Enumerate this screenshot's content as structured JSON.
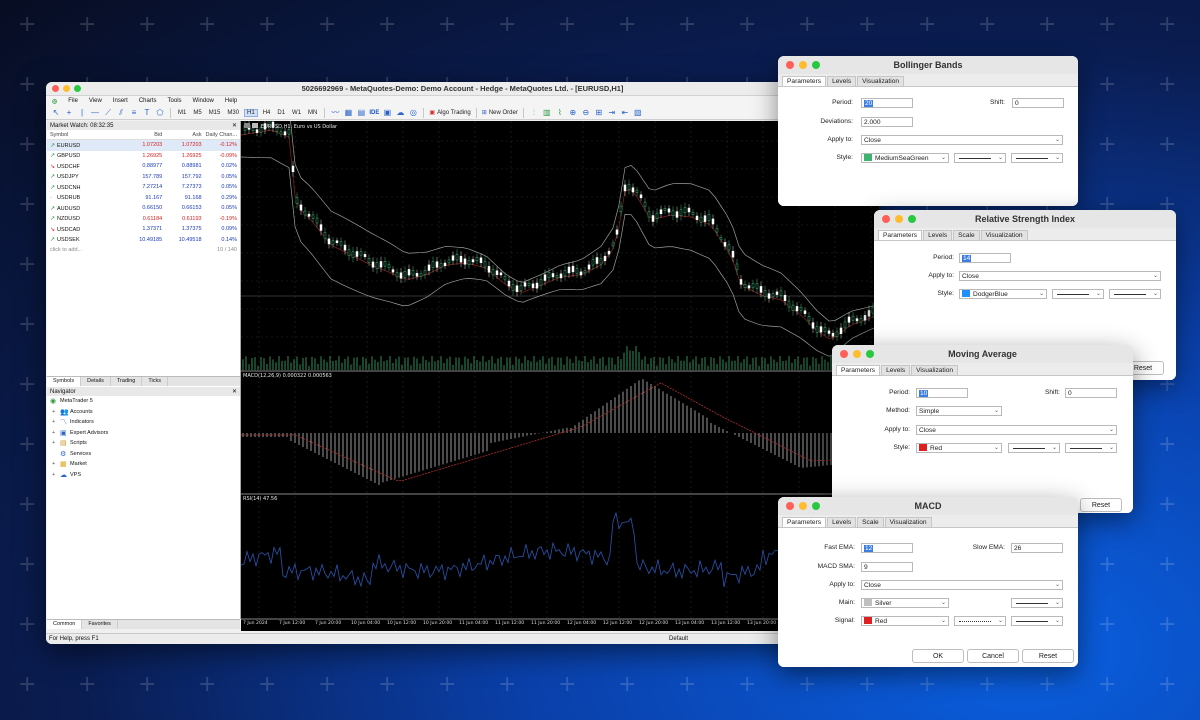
{
  "window": {
    "title": "5026692969 - MetaQuotes-Demo: Demo Account - Hedge - MetaQuotes Ltd. - [EURUSD,H1]",
    "menu": [
      "File",
      "View",
      "Insert",
      "Charts",
      "Tools",
      "Window",
      "Help"
    ],
    "timeframes": [
      "M1",
      "M5",
      "M15",
      "M30",
      "H1",
      "H4",
      "D1",
      "W1",
      "MN"
    ],
    "active_timeframe": "H1",
    "ide_label": "IDE",
    "algo_label": "Algo Trading",
    "new_order_label": "New Order"
  },
  "market_watch": {
    "title": "Market Watch: 08:32:35",
    "columns": [
      "Symbol",
      "Bid",
      "Ask",
      "Daily Chan..."
    ],
    "rows": [
      {
        "symbol": "EURUSD",
        "bid": "1.07203",
        "ask": "1.07203",
        "change": "-0.12%",
        "dir": "up",
        "neg": true
      },
      {
        "symbol": "GBPUSD",
        "bid": "1.26925",
        "ask": "1.26925",
        "change": "-0.09%",
        "dir": "up",
        "neg": true
      },
      {
        "symbol": "USDCHF",
        "bid": "0.88977",
        "ask": "0.88981",
        "change": "0.02%",
        "dir": "down",
        "neg": false
      },
      {
        "symbol": "USDJPY",
        "bid": "157.789",
        "ask": "157.792",
        "change": "0.05%",
        "dir": "up",
        "neg": false
      },
      {
        "symbol": "USDCNH",
        "bid": "7.27214",
        "ask": "7.27373",
        "change": "0.05%",
        "dir": "up",
        "neg": false
      },
      {
        "symbol": "USDRUB",
        "bid": "91.167",
        "ask": "91.168",
        "change": "0.29%",
        "dir": "none",
        "neg": false
      },
      {
        "symbol": "AUDUSD",
        "bid": "0.66150",
        "ask": "0.66153",
        "change": "0.05%",
        "dir": "up",
        "neg": false
      },
      {
        "symbol": "NZDUSD",
        "bid": "0.61184",
        "ask": "0.61193",
        "change": "-0.19%",
        "dir": "up",
        "neg": true
      },
      {
        "symbol": "USDCAD",
        "bid": "1.37371",
        "ask": "1.37375",
        "change": "0.09%",
        "dir": "down",
        "neg": false
      },
      {
        "symbol": "USDSEK",
        "bid": "10.49185",
        "ask": "10.49518",
        "change": "0.14%",
        "dir": "up",
        "neg": false
      }
    ],
    "add_label": "click to add...",
    "count": "10 / 140",
    "tabs": [
      "Symbols",
      "Details",
      "Trading",
      "Ticks"
    ]
  },
  "navigator": {
    "title": "Navigator",
    "root": "MetaTrader 5",
    "items": [
      "Accounts",
      "Indicators",
      "Expert Advisors",
      "Scripts",
      "Services",
      "Market",
      "VPS"
    ],
    "tabs": [
      "Common",
      "Favorites"
    ]
  },
  "status": {
    "help": "For Help, press F1",
    "profile": "Default"
  },
  "chart": {
    "symbol_label": "EURUSD,H1:  Euro vs US Dollar",
    "macd_label": "MACD(12,26,9) 0.000322 0.000563",
    "rsi_label": "RSI(14) 47.56",
    "x_labels": [
      "7 Jun 2024",
      "7 Jun 12:00",
      "7 Jun 20:00",
      "10 Jun 04:00",
      "10 Jun 12:00",
      "10 Jun 20:00",
      "11 Jun 04:00",
      "11 Jun 12:00",
      "11 Jun 20:00",
      "12 Jun 04:00",
      "12 Jun 12:00",
      "12 Jun 20:00",
      "13 Jun 04:00",
      "13 Jun 12:00",
      "13 Jun 20:00"
    ]
  },
  "bollinger": {
    "title": "Bollinger Bands",
    "tabs": [
      "Parameters",
      "Levels",
      "Visualization"
    ],
    "period_label": "Period:",
    "period": "20",
    "shift_label": "Shift:",
    "shift": "0",
    "dev_label": "Deviations:",
    "deviations": "2.000",
    "apply_label": "Apply to:",
    "apply": "Close",
    "style_label": "Style:",
    "color_name": "MediumSeaGreen",
    "color": "#3cb371"
  },
  "rsi": {
    "title": "Relative Strength Index",
    "tabs": [
      "Parameters",
      "Levels",
      "Scale",
      "Visualization"
    ],
    "period_label": "Period:",
    "period": "14",
    "apply_label": "Apply to:",
    "apply": "Close",
    "style_label": "Style:",
    "color_name": "DodgerBlue",
    "color": "#1e90ff",
    "reset": "Reset"
  },
  "ma": {
    "title": "Moving Average",
    "tabs": [
      "Parameters",
      "Levels",
      "Visualization"
    ],
    "period_label": "Period:",
    "period": "10",
    "shift_label": "Shift:",
    "shift": "0",
    "method_label": "Method:",
    "method": "Simple",
    "apply_label": "Apply to:",
    "apply": "Close",
    "style_label": "Style:",
    "color_name": "Red",
    "color": "#e02020",
    "reset": "Reset"
  },
  "macd": {
    "title": "MACD",
    "tabs": [
      "Parameters",
      "Levels",
      "Scale",
      "Visualization"
    ],
    "fast_label": "Fast EMA:",
    "fast": "12",
    "slow_label": "Slow EMA:",
    "slow": "26",
    "sma_label": "MACD SMA:",
    "sma": "9",
    "apply_label": "Apply to:",
    "apply": "Close",
    "main_label": "Main:",
    "main_color_name": "Silver",
    "main_color": "#c0c0c0",
    "signal_label": "Signal:",
    "signal_color_name": "Red",
    "signal_color": "#e02020",
    "ok": "OK",
    "cancel": "Cancel",
    "reset": "Reset"
  }
}
